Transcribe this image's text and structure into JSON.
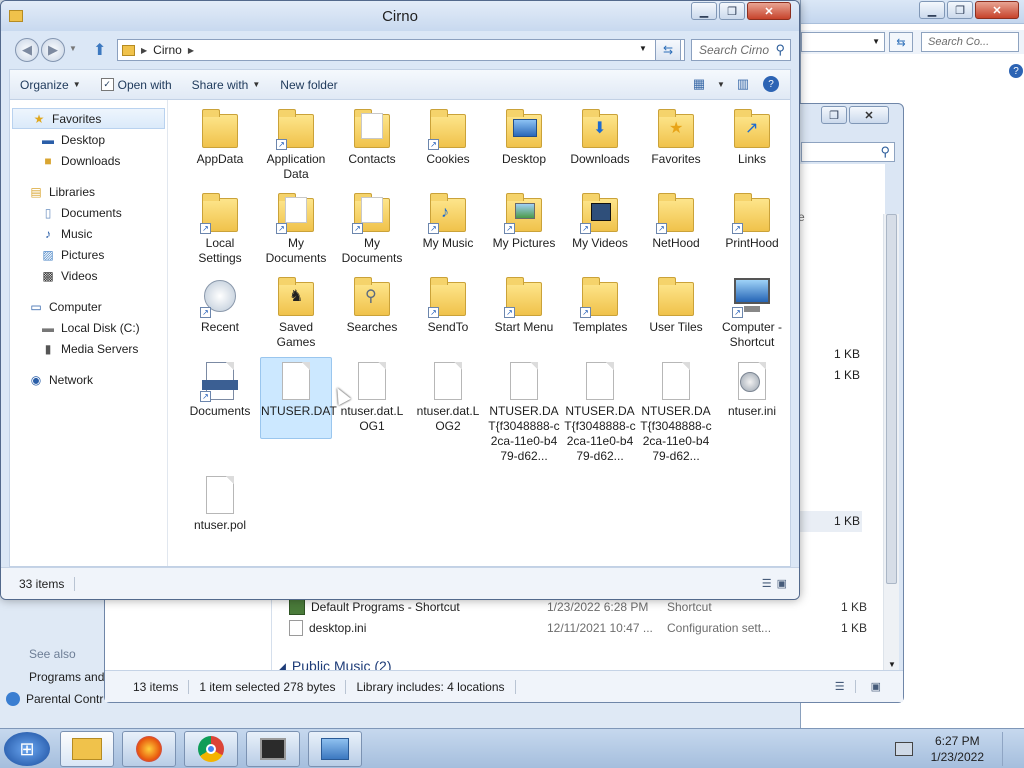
{
  "background_window": {
    "search_placeholder": "Search Co..."
  },
  "mid_window": {
    "status": {
      "items": "13 items",
      "selected": "1 item selected 278 bytes",
      "library": "Library includes: 4 locations"
    },
    "column_hint": "ze",
    "side_sizes": [
      "1 KB",
      "1 KB",
      "1 KB"
    ],
    "rows": [
      {
        "name": "Default Programs - Shortcut",
        "date": "1/23/2022 6:28 PM",
        "type": "Shortcut",
        "size": "1 KB"
      },
      {
        "name": "desktop.ini",
        "date": "12/11/2021 10:47 ...",
        "type": "Configuration sett...",
        "size": "1 KB"
      }
    ],
    "group_header": "Public Music (2)"
  },
  "main_window": {
    "title": "Cirno",
    "breadcrumb": "Cirno",
    "search_placeholder": "Search Cirno",
    "toolbar": {
      "organize": "Organize",
      "open_with": "Open with",
      "share_with": "Share with",
      "new_folder": "New folder"
    },
    "nav": {
      "favorites": "Favorites",
      "desktop": "Desktop",
      "downloads": "Downloads",
      "libraries": "Libraries",
      "documents": "Documents",
      "music": "Music",
      "pictures": "Pictures",
      "videos": "Videos",
      "computer": "Computer",
      "local_disk": "Local Disk (C:)",
      "media_servers": "Media Servers",
      "network": "Network"
    },
    "items": [
      "AppData",
      "Application Data",
      "Contacts",
      "Cookies",
      "Desktop",
      "Downloads",
      "Favorites",
      "Links",
      "Local Settings",
      "My Documents",
      "My Documents",
      "My Music",
      "My Pictures",
      "My Videos",
      "NetHood",
      "PrintHood",
      "Recent",
      "Saved Games",
      "Searches",
      "SendTo",
      "Start Menu",
      "Templates",
      "User Tiles",
      "Computer - Shortcut",
      "Documents",
      "NTUSER.DAT",
      "ntuser.dat.LOG1",
      "ntuser.dat.LOG2",
      "NTUSER.DAT{f3048888-c2ca-11e0-b479-d62...",
      "NTUSER.DAT{f3048888-c2ca-11e0-b479-d62...",
      "NTUSER.DAT{f3048888-c2ca-11e0-b479-d62...",
      "ntuser.ini",
      "ntuser.pol"
    ],
    "status_count": "33 items"
  },
  "left_edge": {
    "see_also": "See also",
    "programs": "Programs and",
    "parental": "Parental Contr"
  },
  "taskbar": {
    "time": "6:27 PM",
    "date": "1/23/2022"
  },
  "colors": {
    "selection": "#cce8ff",
    "folder": "#f0c24b",
    "taskbar": "#a5bedd"
  }
}
